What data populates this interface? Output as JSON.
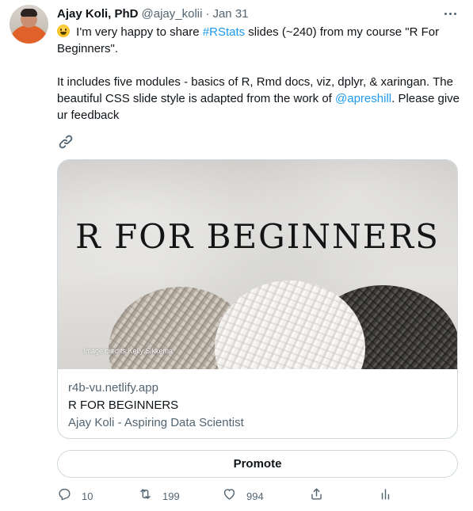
{
  "tweet": {
    "author_name": "Ajay Koli, PhD",
    "author_handle": "@ajay_kolii",
    "separator": "·",
    "date": "Jan 31",
    "text": {
      "p1_prefix": " I'm very happy to share ",
      "hashtag": "#RStats",
      "p1_suffix": " slides (~240) from my course \"R For Beginners\".",
      "p2_prefix": "It includes five modules - basics of R, Rmd docs, viz, dplyr, & xaringan. The beautiful CSS slide style is adapted from the work of ",
      "mention": "@apreshill",
      "p2_suffix": ". Please give ur feedback"
    }
  },
  "card": {
    "image_title": "R FOR BEGINNERS",
    "image_credit": "Image credits:Kelly Sikkema",
    "domain": "r4b-vu.netlify.app",
    "title": "R FOR BEGINNERS",
    "description": "Ajay Koli - Aspiring Data Scientist"
  },
  "promote_label": "Promote",
  "actions": {
    "reply_count": "10",
    "retweet_count": "199",
    "like_count": "994"
  },
  "icons": {
    "avatar": "profile-photo",
    "emoji": "grinning-face-emoji",
    "more": "more-options-icon",
    "link": "link-icon",
    "reply": "reply-icon",
    "retweet": "retweet-icon",
    "like": "heart-icon",
    "share": "share-icon",
    "analytics": "analytics-icon"
  },
  "colors": {
    "link": "#1d9bf0",
    "text": "#0f1419",
    "secondary_text": "#536471",
    "border": "#cfd9de"
  }
}
